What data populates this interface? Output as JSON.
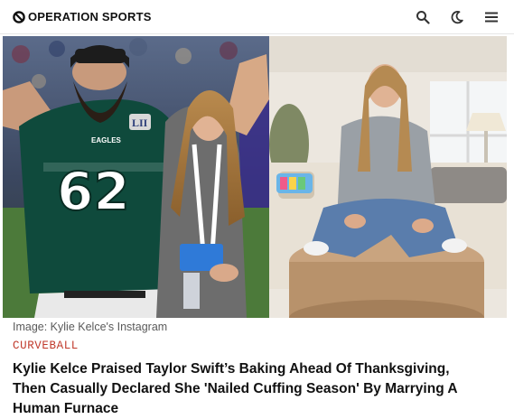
{
  "brand": {
    "name": "OPERATION SPORTS",
    "logo_icon": "os-logo-icon"
  },
  "nav": {
    "icons": [
      "search-icon",
      "dark-mode-moon-icon",
      "hamburger-menu-icon"
    ]
  },
  "hero": {
    "left_photo": {
      "jersey_number": "62",
      "jersey_brand": "EAGLES",
      "patch": "LII"
    }
  },
  "article": {
    "caption": "Image: Kylie Kelce's Instagram",
    "category": "CURVEBALL",
    "headline_lines": [
      "Kylie Kelce Praised Taylor Swift’s Baking Ahead Of Thanksgiving,",
      "Then Casually Declared She 'Nailed Cuffing Season' By Marrying A",
      "Human Furnace"
    ]
  },
  "colors": {
    "category": "#c0392b",
    "jersey_green": "#0f4a3c",
    "accent_blue": "#2f7ad8"
  }
}
